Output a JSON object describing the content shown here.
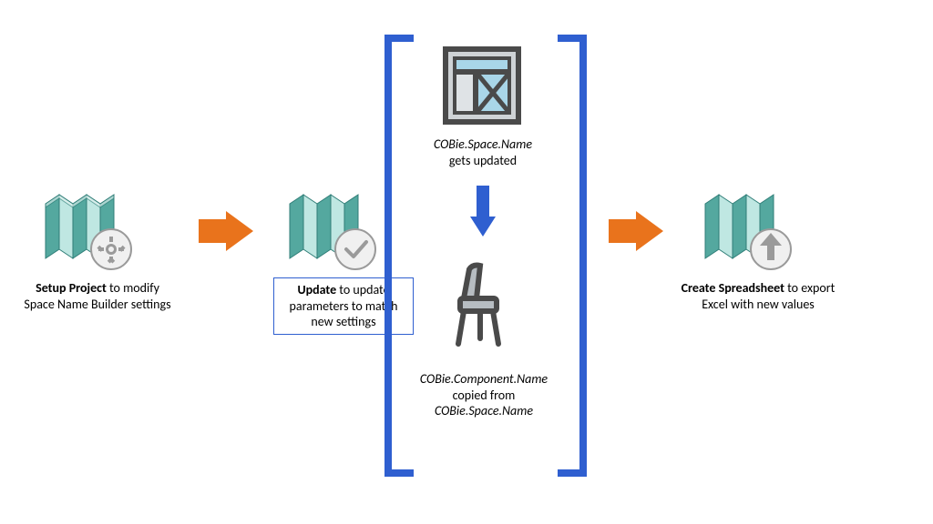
{
  "diagram": {
    "step1": {
      "title": "Setup Project",
      "rest": " to modify Space Name Builder settings"
    },
    "step2": {
      "title": "Update",
      "rest": " to update parameters to match new settings"
    },
    "middle": {
      "top_line1": "COBie.Space.Name",
      "top_line2": "gets updated",
      "bottom_line1": "COBie.Component.Name",
      "bottom_line2": "copied from",
      "bottom_line3": "COBie.Space.Name"
    },
    "step3": {
      "title": "Create Spreadsheet",
      "rest": " to export Excel with new values"
    }
  },
  "icons": {
    "badge_gear": "gear-icon",
    "badge_check": "checkmark-icon",
    "badge_up": "upload-arrow-icon",
    "space": "floorplan-space-icon",
    "component": "chair-component-icon"
  },
  "colors": {
    "orange": "#e9731c",
    "blue": "#2f5fd0",
    "teal_dark": "#2f7d77",
    "teal_light": "#8fd1ca",
    "grey": "#9a9a9a",
    "grey_dark": "#5c5c5c"
  }
}
